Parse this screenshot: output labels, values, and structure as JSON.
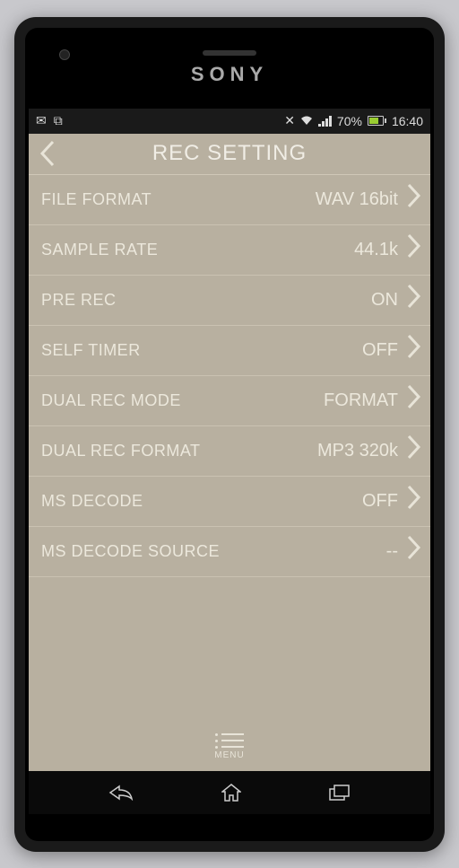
{
  "phone_brand": "SONY",
  "status_bar": {
    "battery_pct": "70%",
    "time": "16:40"
  },
  "app": {
    "title": "REC SETTING",
    "settings": [
      {
        "label": "FILE FORMAT",
        "value": "WAV 16bit"
      },
      {
        "label": "SAMPLE RATE",
        "value": "44.1k"
      },
      {
        "label": "PRE REC",
        "value": "ON"
      },
      {
        "label": "SELF TIMER",
        "value": "OFF"
      },
      {
        "label": "DUAL REC MODE",
        "value": "FORMAT"
      },
      {
        "label": "DUAL REC FORMAT",
        "value": "MP3 320k"
      },
      {
        "label": "MS DECODE",
        "value": "OFF"
      },
      {
        "label": "MS DECODE SOURCE",
        "value": "--"
      }
    ],
    "menu_label": "MENU"
  }
}
